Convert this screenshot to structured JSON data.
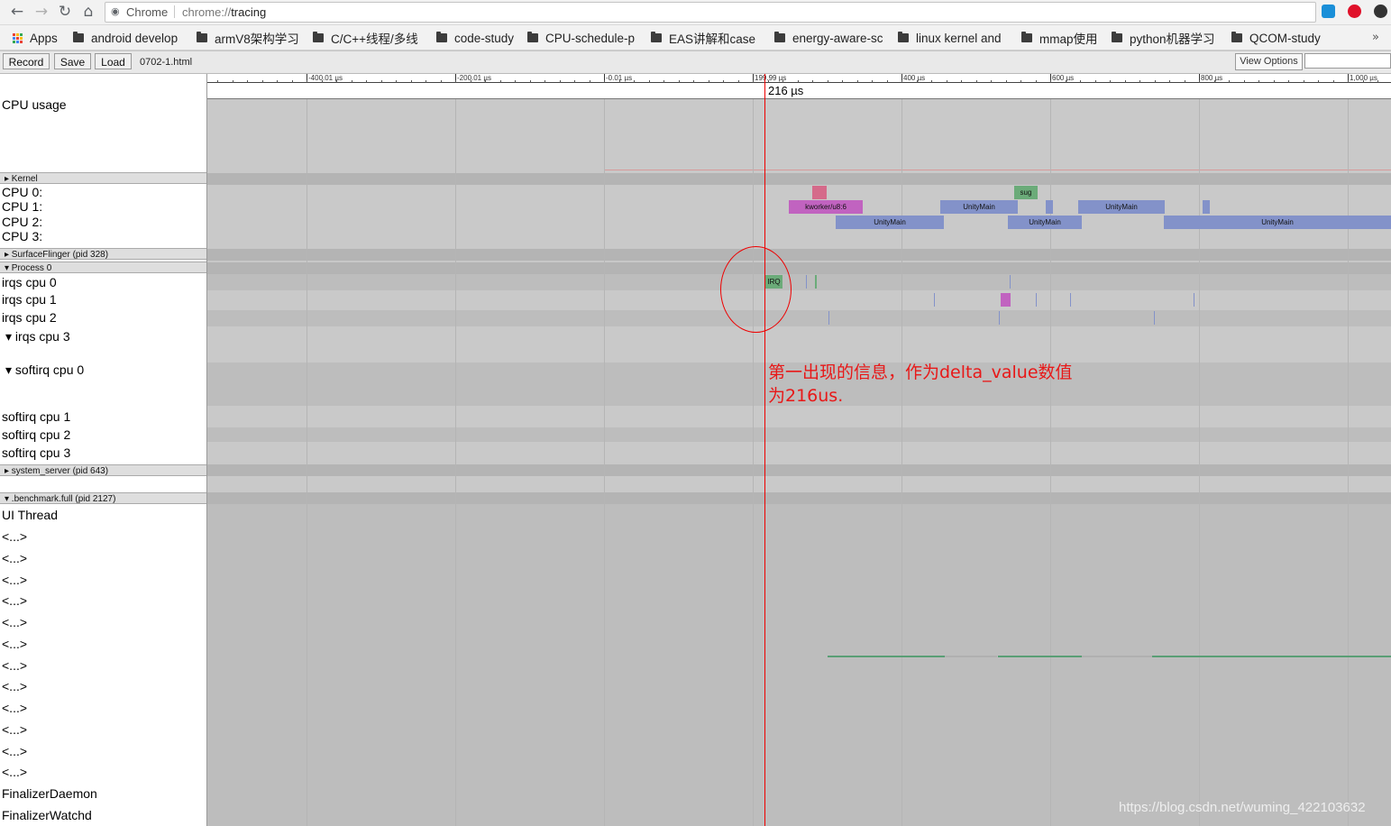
{
  "browser": {
    "omnibox_label": "Chrome",
    "url_scheme": "chrome://",
    "url_host": "tracing"
  },
  "bookmarks": [
    {
      "label": "Apps",
      "icon": "apps-grid-icon"
    },
    {
      "label": "android develop",
      "icon": "folder-icon"
    },
    {
      "label": "armV8架构学习",
      "icon": "folder-icon"
    },
    {
      "label": "C/C++线程/多线",
      "icon": "folder-icon"
    },
    {
      "label": "code-study",
      "icon": "folder-icon"
    },
    {
      "label": "CPU-schedule-p",
      "icon": "folder-icon"
    },
    {
      "label": "EAS讲解和case",
      "icon": "folder-icon"
    },
    {
      "label": "energy-aware-sc",
      "icon": "folder-icon"
    },
    {
      "label": "linux kernel and",
      "icon": "folder-icon"
    },
    {
      "label": "mmap使用",
      "icon": "folder-icon"
    },
    {
      "label": "python机器学习",
      "icon": "folder-icon"
    },
    {
      "label": "QCOM-study",
      "icon": "folder-icon"
    }
  ],
  "bookmarks_more": "»",
  "toolbar": {
    "record": "Record",
    "save": "Save",
    "load": "Load",
    "filename": "0702-1.html",
    "view_options": "View Options"
  },
  "ruler": {
    "tick_labels": [
      "-400.01 µs",
      "-200.01 µs",
      "-0.01 µs",
      "199.99 µs",
      "400 µs",
      "600 µs",
      "800 µs",
      "1,000 µs"
    ],
    "cursor_label": "216 µs"
  },
  "labels": {
    "cpu_usage": "CPU usage",
    "kernel": "▸ Kernel",
    "cpu0": "CPU 0:",
    "cpu1": "CPU 1:",
    "cpu2": "CPU 2:",
    "cpu3": "CPU 3:",
    "surfaceflinger": "▸ SurfaceFlinger (pid 328)",
    "process0": "▾ Process 0",
    "irqs0": "irqs cpu 0",
    "irqs1": "irqs cpu 1",
    "irqs2": "irqs cpu 2",
    "irqs3": "▾  irqs cpu 3",
    "softirq0": "▾  softirq cpu 0",
    "softirq1": "softirq cpu 1",
    "softirq2": "softirq cpu 2",
    "softirq3": "softirq cpu 3",
    "system_server": "▸ system_server (pid 643)",
    "benchmark": "▾ .benchmark.full (pid 2127)",
    "ui_thread": "UI Thread",
    "thread_placeholder": "<...>",
    "finalizer_daemon": "FinalizerDaemon",
    "finalizer_watchdog": "FinalizerWatchd"
  },
  "slices": {
    "kworker": "kworker/u8:6",
    "sug": "sug",
    "unity": "UnityMain",
    "irq": "IRQ"
  },
  "annotation": {
    "note": "第一出现的信息，作为delta_value数值\n为216us."
  },
  "watermark": "https://blog.csdn.net/wuming_422103632",
  "colors": {
    "cursor": "#e00000",
    "kworker": "#c163c0",
    "unity": "#8392c9",
    "sug": "#6bab79",
    "irq": "#6bab79",
    "pink": "#d56a8a",
    "green_line": "#5a9e75"
  }
}
